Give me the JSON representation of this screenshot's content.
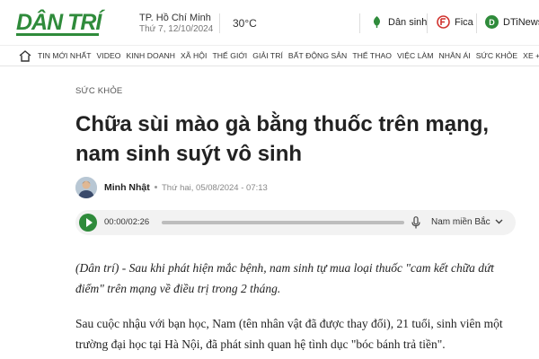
{
  "header": {
    "logo_text": "DÂN TRÍ",
    "location": "TP. Hồ Chí Minh",
    "date": "Thứ 7, 12/10/2024",
    "temperature": "30°C",
    "links": [
      {
        "label": "Dân sinh",
        "icon": "dan-sinh-icon",
        "color": "#2f8b3b"
      },
      {
        "label": "Fica",
        "icon": "fica-icon",
        "color": "#d0312d"
      },
      {
        "label": "DTiNews",
        "icon": "dtinews-icon",
        "color": "#2f8b3b"
      }
    ]
  },
  "nav": {
    "home_icon": "home-icon",
    "items": [
      "TIN MỚI NHẤT",
      "VIDEO",
      "KINH DOANH",
      "XÃ HỘI",
      "THẾ GIỚI",
      "GIẢI TRÍ",
      "BẤT ĐỘNG SẢN",
      "THỂ THAO",
      "VIỆC LÀM",
      "NHÂN ÁI",
      "SỨC KHỎE",
      "XE ++"
    ]
  },
  "article": {
    "category": "SỨC KHỎE",
    "title": "Chữa sùi mào gà bằng thuốc trên mạng, nam sinh suýt vô sinh",
    "author": "Minh Nhật",
    "published": "Thứ hai, 05/08/2024 - 07:13",
    "lead": "(Dân trí) - Sau khi phát hiện mắc bệnh, nam sinh tự mua loại thuốc \"cam kết chữa dứt điểm\" trên mạng về điều trị trong 2 tháng.",
    "paragraph": "Sau cuộc nhậu với bạn học, Nam (tên nhân vật đã được thay đổi), 21 tuổi, sinh viên một trường đại học tại Hà Nội, đã phát sinh quan hệ tình dục \"bóc bánh trả tiền\"."
  },
  "player": {
    "time": "00:00/02:26",
    "voice": "Nam miền Bắc",
    "progress": 0
  },
  "colors": {
    "brand": "#2f8b3b"
  }
}
